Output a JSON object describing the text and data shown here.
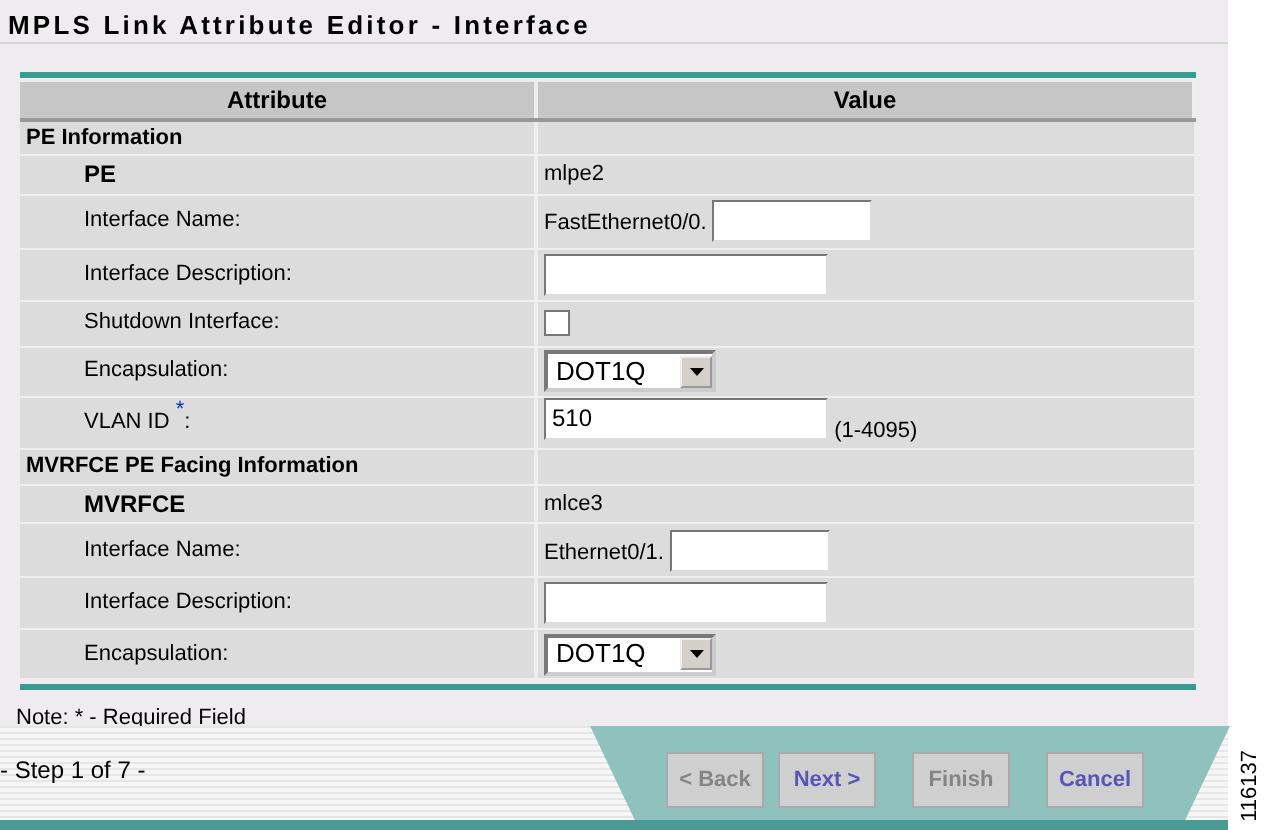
{
  "window": {
    "title": "MPLS Link Attribute Editor - Interface"
  },
  "table": {
    "columns": [
      "Attribute",
      "Value"
    ],
    "sections": [
      {
        "title": "PE Information",
        "rows": [
          {
            "kind": "static",
            "label": "PE",
            "value": "mlpe2"
          },
          {
            "kind": "field",
            "label": "Interface Name:",
            "prefix": "FastEthernet0/0."
          },
          {
            "kind": "field",
            "label": "Interface Description:"
          },
          {
            "kind": "checkbox",
            "label": "Shutdown Interface:",
            "checked": false
          },
          {
            "kind": "select",
            "label": "Encapsulation:",
            "value": "DOT1Q"
          },
          {
            "kind": "field",
            "label": "VLAN ID $^{*}$:",
            "value": "510",
            "hint": "(1-4095)"
          }
        ]
      },
      {
        "title": "MVRFCE PE Facing Information",
        "rows": [
          {
            "kind": "static",
            "label": "MVRFCE",
            "value": "mlce3"
          },
          {
            "kind": "field",
            "label": "Interface Name:",
            "prefix": "Ethernet0/1."
          },
          {
            "kind": "field",
            "label": "Interface Description:"
          },
          {
            "kind": "select",
            "label": "Encapsulation:",
            "value": "DOT1Q"
          }
        ]
      }
    ]
  },
  "note": "Note: * - Required Field",
  "footer": {
    "step": "- Step 1 of 7 -",
    "buttons": [
      {
        "label": "< Back",
        "disabled": true
      },
      {
        "label": "Next >",
        "disabled": false
      },
      {
        "label": "Finish",
        "disabled": true
      },
      {
        "label": "Cancel",
        "disabled": false
      }
    ]
  },
  "figure_number": "116137"
}
